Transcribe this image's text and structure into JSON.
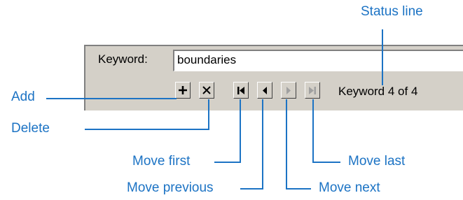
{
  "keyword": {
    "label": "Keyword:",
    "value": "boundaries"
  },
  "status": {
    "text": "Keyword 4 of 4"
  },
  "toolbar": {
    "buttons": [
      {
        "icon": "plus-icon",
        "enabled": true
      },
      {
        "icon": "cross-icon",
        "enabled": true
      },
      {
        "icon": "move-first-icon",
        "enabled": true
      },
      {
        "icon": "move-previous-icon",
        "enabled": true
      },
      {
        "icon": "move-next-icon",
        "enabled": false
      },
      {
        "icon": "move-last-icon",
        "enabled": false
      }
    ]
  },
  "callouts": {
    "status_line": "Status line",
    "add": "Add",
    "delete": "Delete",
    "move_first": "Move first",
    "move_previous": "Move previous",
    "move_next": "Move next",
    "move_last": "Move last"
  },
  "colors": {
    "callout": "#1c73c4",
    "panel": "#d4d0c8",
    "disabled_icon": "#a0a0a0"
  }
}
